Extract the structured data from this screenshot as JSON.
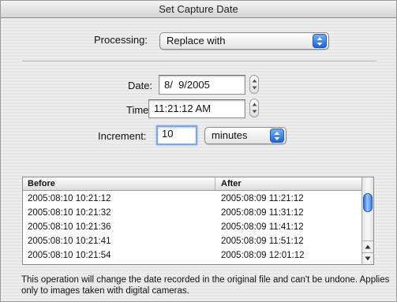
{
  "window": {
    "title": "Set Capture Date"
  },
  "processing": {
    "label": "Processing:",
    "value": "Replace with"
  },
  "date": {
    "label": "Date:",
    "value": "8/  9/2005"
  },
  "time": {
    "label": "Time:",
    "value": "11:21:12 AM"
  },
  "increment": {
    "label": "Increment:",
    "value": "10",
    "unit": "minutes"
  },
  "table": {
    "columns": [
      "Before",
      "After"
    ],
    "rows": [
      {
        "before": "2005:08:10 10:21:12",
        "after": "2005:08:09 11:21:12"
      },
      {
        "before": "2005:08:10 10:21:32",
        "after": "2005:08:09 11:31:12"
      },
      {
        "before": "2005:08:10 10:21:36",
        "after": "2005:08:09 11:41:12"
      },
      {
        "before": "2005:08:10 10:21:41",
        "after": "2005:08:09 11:51:12"
      },
      {
        "before": "2005:08:10 10:21:54",
        "after": "2005:08:09 12:01:12"
      }
    ]
  },
  "footnote": "This operation will change the date recorded in the original file and can't be undone. Applies only to images taken with digital cameras.",
  "colors": {
    "accent": "#1c64d8",
    "focus_ring": "#7ea7e0"
  }
}
